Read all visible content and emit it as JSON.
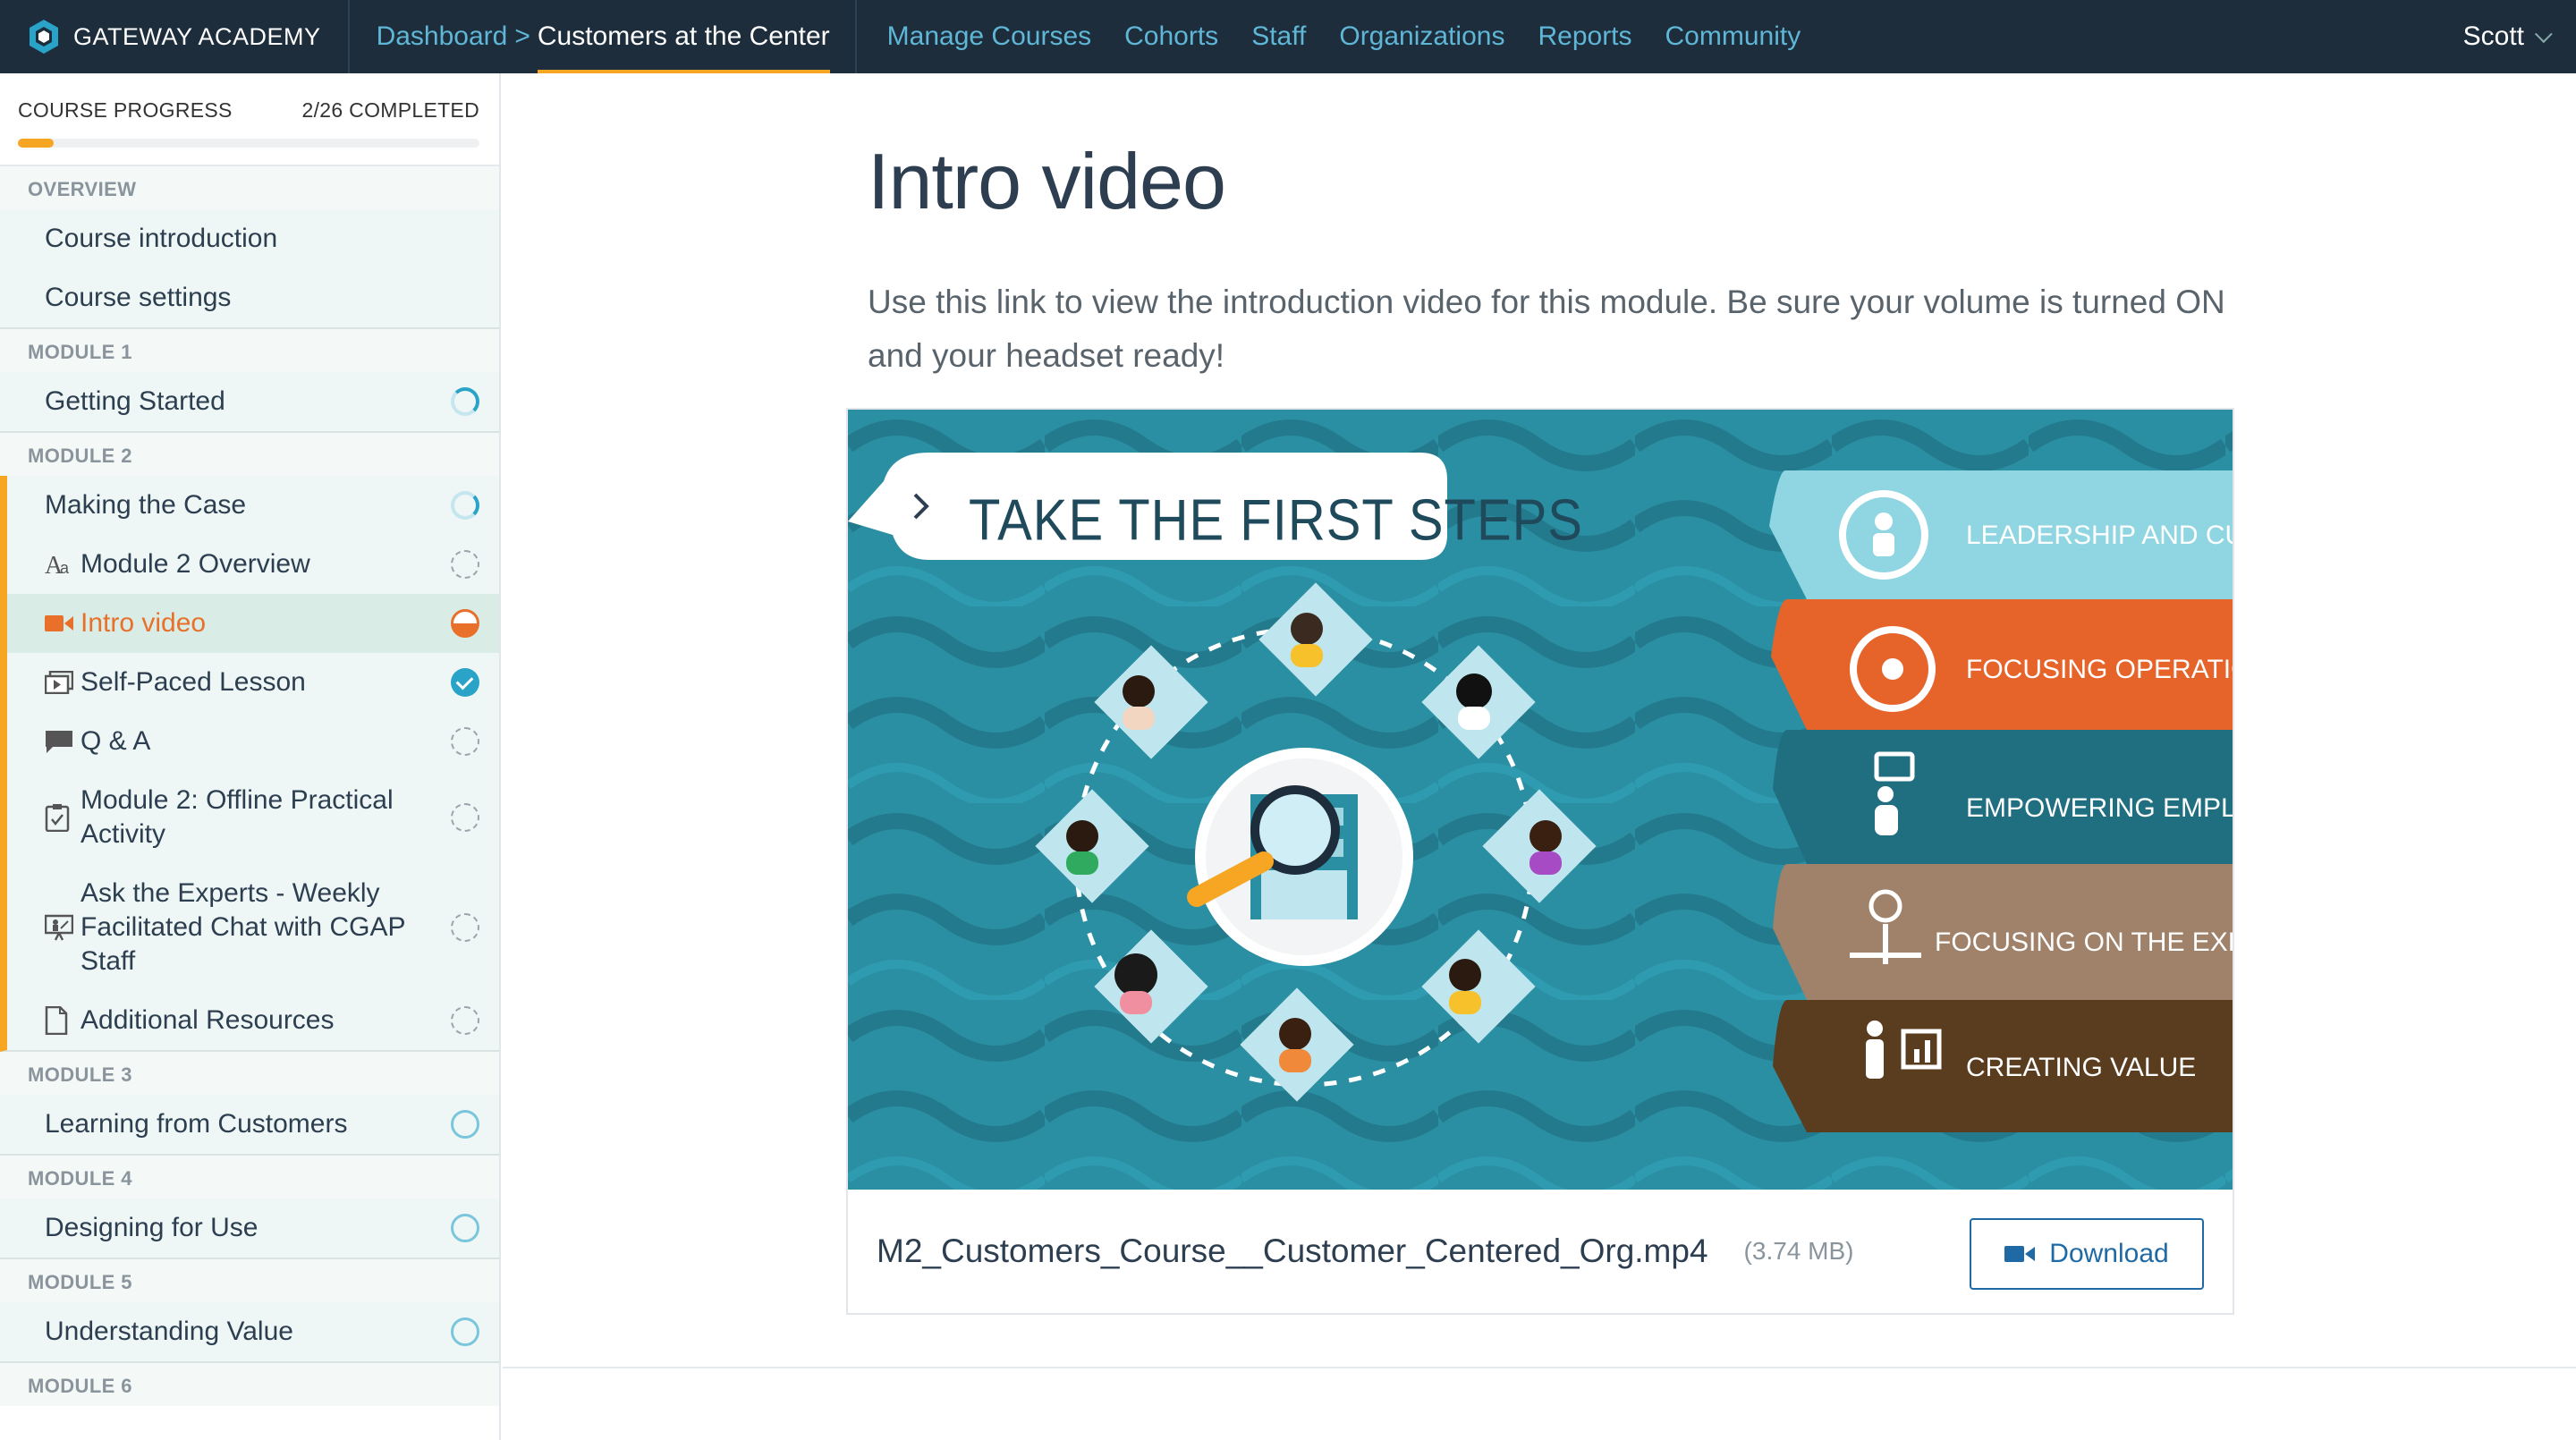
{
  "nav": {
    "brand": "GATEWAY ACADEMY",
    "crumb_link": "Dashboard",
    "crumb_sep": ">",
    "crumb_current": "Customers at the Center",
    "links": [
      "Manage Courses",
      "Cohorts",
      "Staff",
      "Organizations",
      "Reports",
      "Community"
    ],
    "user": "Scott"
  },
  "progress": {
    "label": "COURSE PROGRESS",
    "completed_text": "2/26 COMPLETED",
    "fraction": 0.077
  },
  "sidebar": {
    "sections": [
      {
        "label": "OVERVIEW",
        "items": [
          {
            "label": "Course introduction",
            "status": "none"
          },
          {
            "label": "Course settings",
            "status": "none"
          }
        ]
      },
      {
        "label": "MODULE 1",
        "items": [
          {
            "label": "Getting Started",
            "status": "in-progress"
          }
        ]
      },
      {
        "label": "MODULE 2",
        "items": [
          {
            "label": "Making the Case",
            "status": "in-progress",
            "icon": "none"
          },
          {
            "label": "Module 2 Overview",
            "status": "not-started",
            "icon": "text-icon"
          },
          {
            "label": "Intro video",
            "status": "current",
            "icon": "video-icon"
          },
          {
            "label": "Self-Paced Lesson",
            "status": "done",
            "icon": "lesson-icon"
          },
          {
            "label": "Q & A",
            "status": "not-started",
            "icon": "chat-icon"
          },
          {
            "label": "Module 2: Offline Practical Activity",
            "status": "not-started",
            "icon": "clipboard-icon"
          },
          {
            "label": "Ask the Experts - Weekly Facilitated Chat with CGAP Staff",
            "status": "not-started",
            "icon": "presentation-icon"
          },
          {
            "label": "Additional Resources",
            "status": "not-started",
            "icon": "document-icon"
          }
        ]
      },
      {
        "label": "MODULE 3",
        "items": [
          {
            "label": "Learning from Customers",
            "status": "not-started"
          }
        ]
      },
      {
        "label": "MODULE 4",
        "items": [
          {
            "label": "Designing for Use",
            "status": "not-started"
          }
        ]
      },
      {
        "label": "MODULE 5",
        "items": [
          {
            "label": "Understanding Value",
            "status": "not-started"
          }
        ]
      },
      {
        "label": "MODULE 6",
        "items": []
      }
    ]
  },
  "main": {
    "title": "Intro video",
    "description": "Use this link to view the introduction video for this module. Be sure your volume is turned ON and your headset ready!",
    "video": {
      "banner": "TAKE THE FIRST STEPS",
      "tabs": [
        "LEADERSHIP AND CULTURE",
        "FOCUSING OPERATIONS",
        "EMPOWERING EMPLOYEES",
        "FOCUSING ON THE EXPERIENCE",
        "CREATING VALUE"
      ]
    },
    "file_name": "M2_Customers_Course__Customer_Centered_Org.mp4",
    "file_size": "(3.74 MB)",
    "download_label": "Download"
  },
  "colors": {
    "nav_bg": "#1d2d3b",
    "nav_link": "#5fb6d6",
    "accent": "#f6a623",
    "current": "#e8702a",
    "status_blue": "#2aa3c8",
    "button_blue": "#1f6aa5",
    "video_teal": "#2b8fa3"
  }
}
